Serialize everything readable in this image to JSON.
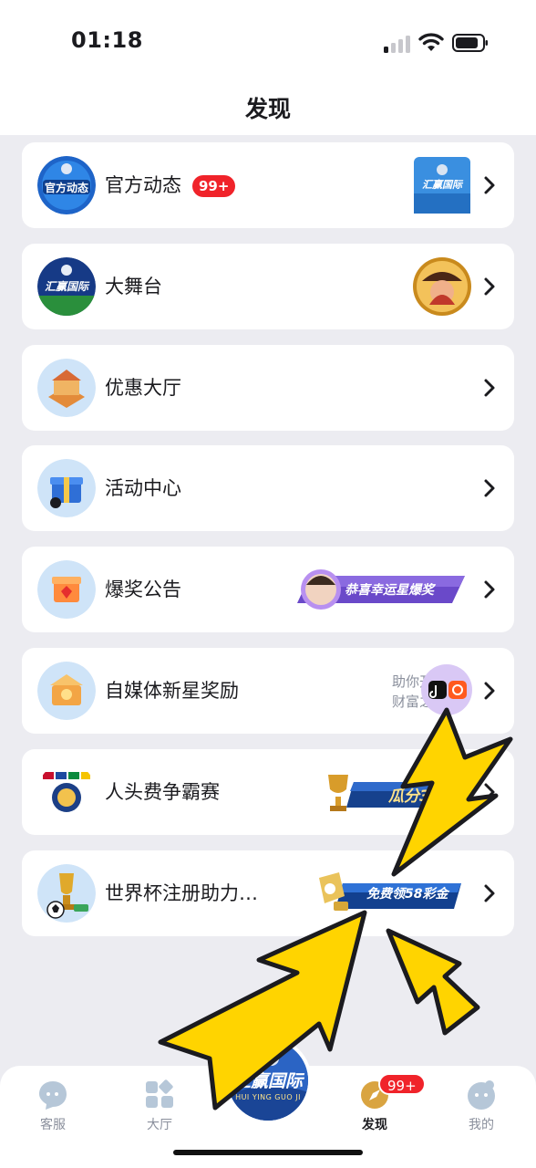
{
  "status_bar": {
    "time": "01:18"
  },
  "header": {
    "title": "发现"
  },
  "list": {
    "items": [
      {
        "label": "官方动态",
        "badge": "99+",
        "icon_text": "官方动态",
        "thumb_text": "汇赢国际"
      },
      {
        "label": "大舞台",
        "icon_text": "汇赢国际"
      },
      {
        "label": "优惠大厅"
      },
      {
        "label": "活动中心"
      },
      {
        "label": "爆奖公告",
        "banner": "恭喜幸运星爆奖"
      },
      {
        "label": "自媒体新星奖励",
        "side_text_1": "助你开启",
        "side_text_2": "财富之路"
      },
      {
        "label": "人头费争霸赛",
        "banner": "瓜分31"
      },
      {
        "label": "世界杯注册助力…",
        "banner": "免费领58彩金"
      }
    ]
  },
  "tabbar": {
    "tabs": [
      {
        "label": "客服",
        "icon": "chat-bubble-icon"
      },
      {
        "label": "大厅",
        "icon": "grid-icon"
      },
      {
        "label": "发现",
        "icon": "compass-icon",
        "badge": "99+"
      },
      {
        "label": "我的",
        "icon": "profile-icon"
      }
    ],
    "center_logo": {
      "text": "汇赢国际",
      "subtext": "HUI YING GUO JI"
    }
  },
  "colors": {
    "accent": "#f0232a",
    "page_bg": "#ececf1",
    "card_bg": "#ffffff",
    "overlay_arrow": "#ffd400"
  }
}
